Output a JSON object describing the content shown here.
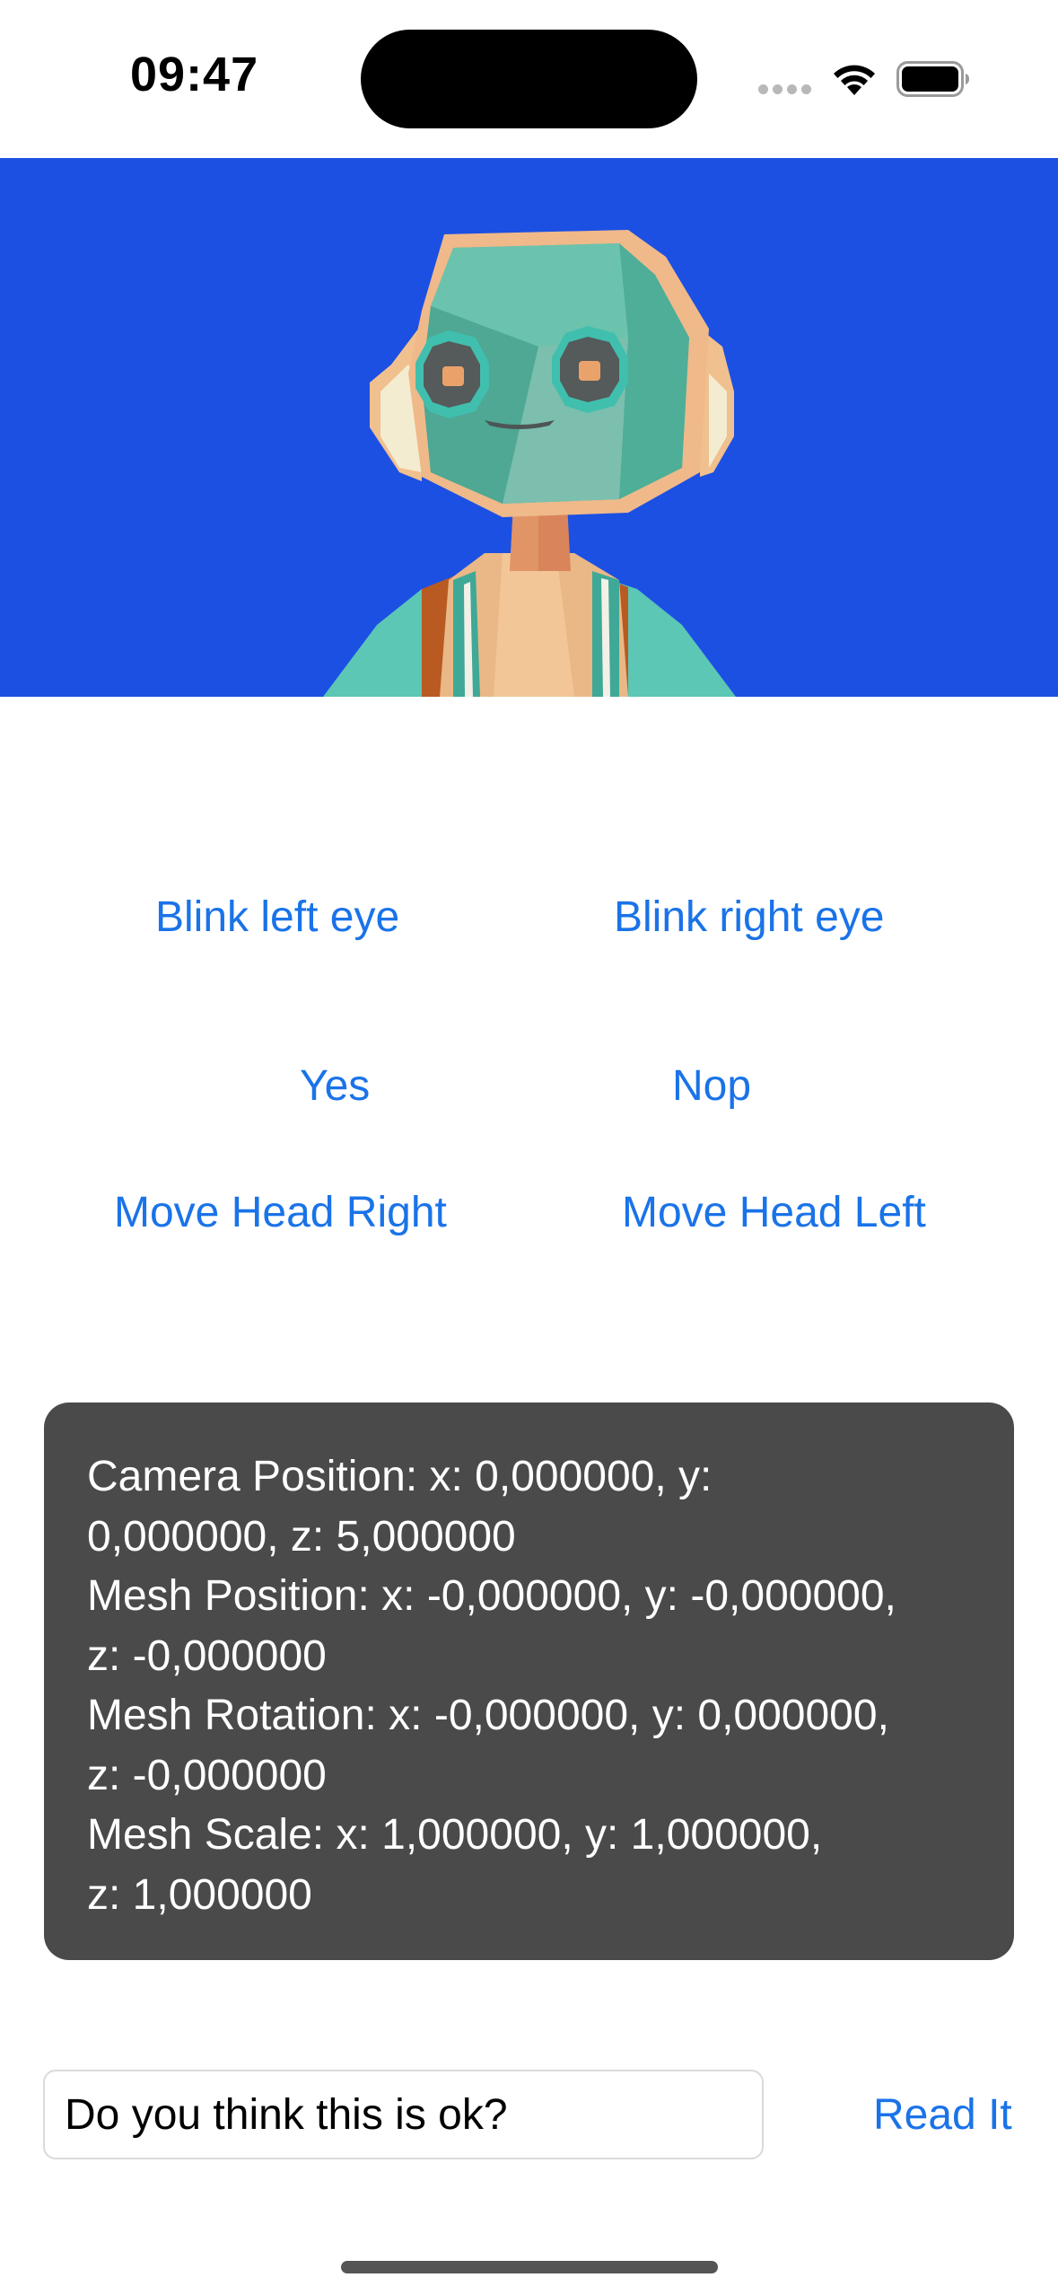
{
  "status_bar": {
    "time": "09:47",
    "icons": [
      "signal-dots-icon",
      "wifi-icon",
      "battery-icon"
    ]
  },
  "viewport": {
    "background": "#1c50e3",
    "subject": "robot-character"
  },
  "buttons": {
    "blink_left": "Blink left eye",
    "blink_right": "Blink right eye",
    "yes": "Yes",
    "nop": "Nop",
    "move_head_right": "Move Head Right",
    "move_head_left": "Move Head Left"
  },
  "info": {
    "lines": [
      "Camera Position: x: 0,000000, y:",
      "0,000000, z: 5,000000",
      "Mesh Position: x: -0,000000, y: -0,000000,",
      "z: -0,000000",
      "Mesh Rotation: x: -0,000000, y: 0,000000,",
      "z: -0,000000",
      "Mesh Scale: x: 1,000000, y: 1,000000,",
      "z: 1,000000"
    ]
  },
  "speech": {
    "input_value": "Do you think this is ok?",
    "read_button": "Read It"
  },
  "colors": {
    "accent": "#1a73e8",
    "panel": "#4a4a4a"
  }
}
